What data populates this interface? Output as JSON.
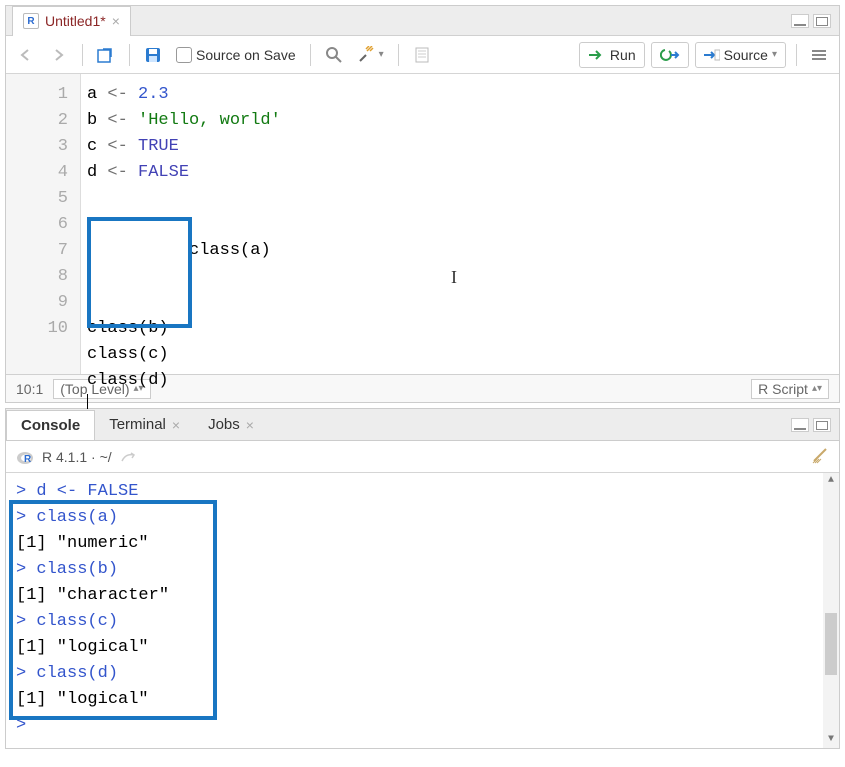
{
  "source_pane": {
    "tab_title": "Untitled1*",
    "toolbar": {
      "source_on_save_label": "Source on Save",
      "run_label": "Run",
      "source_label": "Source"
    },
    "code": {
      "line1_a": "a ",
      "line1_op": "<-",
      "line1_num": " 2.3",
      "line2_a": "b ",
      "line2_op": "<-",
      "line2_str": " 'Hello, world'",
      "line3_a": "c ",
      "line3_op": "<-",
      "line3_const": " TRUE",
      "line4_a": "d ",
      "line4_op": "<-",
      "line4_const": " FALSE",
      "line6": "class(a)",
      "line7": "class(b)",
      "line8": "class(c)",
      "line9": "class(d)"
    },
    "line_numbers": [
      "1",
      "2",
      "3",
      "4",
      "5",
      "6",
      "7",
      "8",
      "9",
      "10"
    ],
    "status": {
      "position": "10:1",
      "scope": "(Top Level)",
      "file_type": "R Script"
    }
  },
  "console_pane": {
    "tabs": {
      "console": "Console",
      "terminal": "Terminal",
      "jobs": "Jobs"
    },
    "subtitle": "R 4.1.1 · ~/",
    "lines": [
      {
        "p": "> ",
        "c": "d <- FALSE"
      },
      {
        "p": "> ",
        "c": "class(a)"
      },
      {
        "o": "[1] \"numeric\""
      },
      {
        "p": "> ",
        "c": "class(b)"
      },
      {
        "o": "[1] \"character\""
      },
      {
        "p": "> ",
        "c": "class(c)"
      },
      {
        "o": "[1] \"logical\""
      },
      {
        "p": "> ",
        "c": "class(d)"
      },
      {
        "o": "[1] \"logical\""
      },
      {
        "p": "> ",
        "c": ""
      }
    ]
  }
}
